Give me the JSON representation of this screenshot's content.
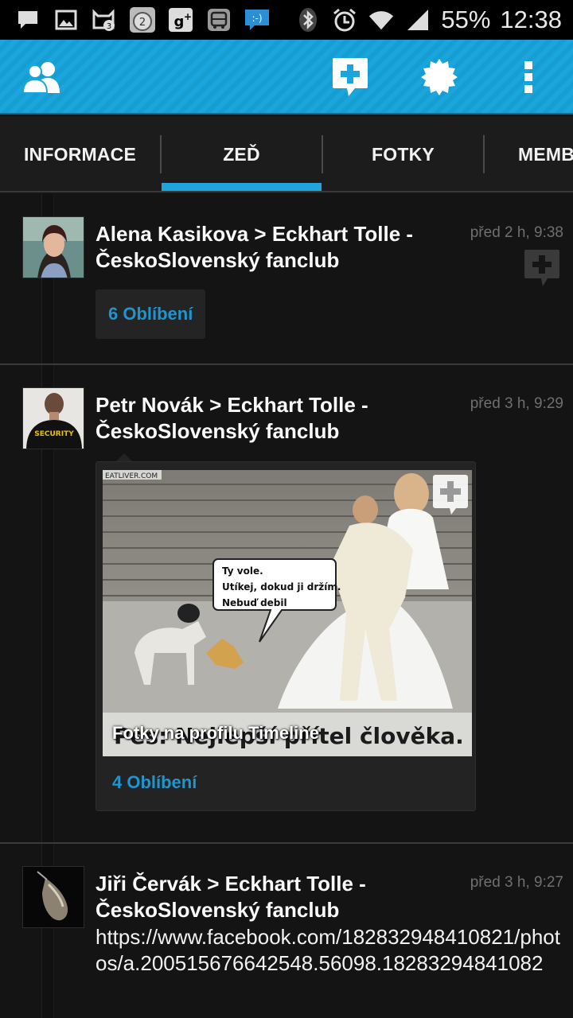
{
  "status_bar": {
    "icons_left": [
      "message-icon",
      "gallery-icon",
      "cat-notification-3-icon",
      "timer-2-icon",
      "google-plus-icon",
      "bus-icon",
      "chat-bubble-icon"
    ],
    "icons_right": [
      "bluetooth-icon",
      "alarm-icon",
      "wifi-icon",
      "signal-icon"
    ],
    "battery": "55%",
    "time": "12:38"
  },
  "action_bar": {
    "left_icon": "group-icon",
    "right_icons": [
      "add-post-icon",
      "badge-icon",
      "overflow-menu-icon"
    ],
    "accent": "#1aa6dc"
  },
  "tabs": [
    {
      "label": "INFORMACE"
    },
    {
      "label": "ZEĎ",
      "selected": true
    },
    {
      "label": "FOTKY"
    },
    {
      "label": "MEMB"
    }
  ],
  "posts": [
    {
      "author": "Alena Kasikova > Eckhart Tolle - ČeskoSlovenský fanclub",
      "time": "před 2 h, 9:38",
      "likes": "6 Oblíbení"
    },
    {
      "author": "Petr Novák > Eckhart Tolle - ČeskoSlovenský fanclub",
      "time": "před 3 h, 9:29",
      "photo": {
        "watermark": "EATLIVER.COM",
        "bubble": [
          "Ty vole.",
          "Utíkej, dokud ji držím.",
          "Nebuď debil"
        ],
        "image_text": "Pes: Nejlepší přítel člověka.",
        "caption": "Fotky na profilu Timeline"
      },
      "likes": "4 Oblíbení"
    },
    {
      "author": "Jiři Červák > Eckhart Tolle - ČeskoSlovenský fanclub",
      "time": "před 3 h, 9:27",
      "text": "https://www.facebook.com/182832948410821/photos/a.200515676642548.56098.18283294841082"
    }
  ]
}
